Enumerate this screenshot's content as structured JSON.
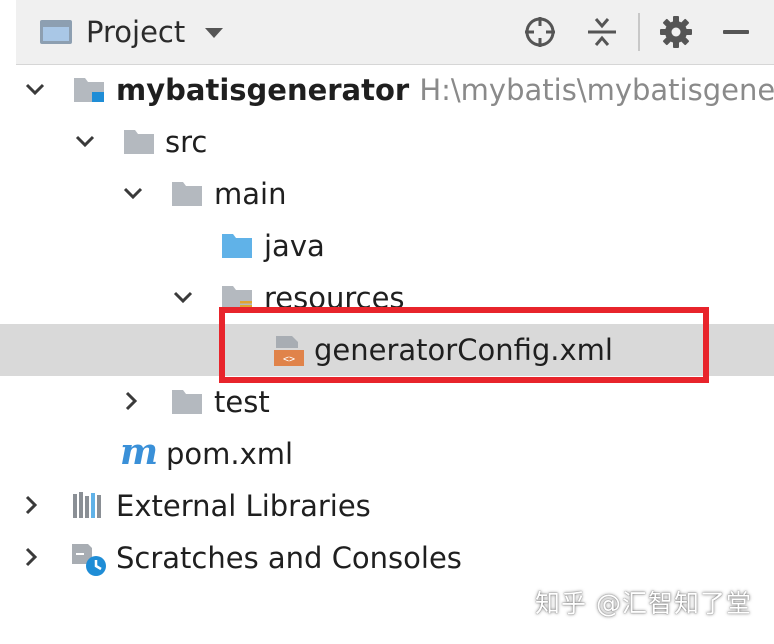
{
  "header": {
    "title": "Project",
    "icons": [
      "project-window-icon",
      "dropdown-caret-icon",
      "locate-target-icon",
      "collapse-all-icon",
      "gear-icon",
      "minimize-icon"
    ]
  },
  "tree": {
    "rows": [
      {
        "name": "mybatisgenerator",
        "path": "H:\\mybatis\\mybatisgener",
        "icon": "module-folder-icon",
        "expanded": true
      },
      {
        "name": "src",
        "icon": "folder-icon",
        "expanded": true
      },
      {
        "name": "main",
        "icon": "folder-icon",
        "expanded": true
      },
      {
        "name": "java",
        "icon": "source-folder-icon"
      },
      {
        "name": "resources",
        "icon": "resources-folder-icon",
        "expanded": true
      },
      {
        "name": "generatorConfig.xml",
        "icon": "xml-file-icon",
        "selected": true
      },
      {
        "name": "test",
        "icon": "folder-icon",
        "expanded": false
      },
      {
        "name": "pom.xml",
        "icon": "maven-pom-icon"
      },
      {
        "name": "External Libraries",
        "icon": "libraries-icon",
        "expanded": false
      },
      {
        "name": "Scratches and Consoles",
        "icon": "scratches-icon",
        "expanded": false
      }
    ]
  },
  "colors": {
    "header_bg": "#f0f0f0",
    "selected_row_bg": "#d9d9d9",
    "highlight_border": "#e8242b",
    "folder_gray": "#b4b9bf",
    "source_blue": "#60b2e8"
  },
  "watermark": "知乎 @汇智知了堂"
}
